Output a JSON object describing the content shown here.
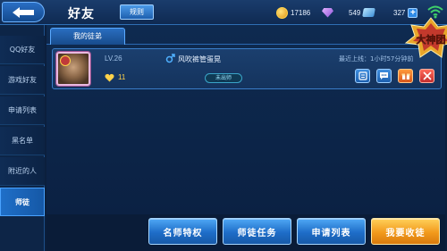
{
  "header": {
    "title": "好友",
    "rules_label": "规则",
    "coins": "17186",
    "gems": "549",
    "tickets": "327",
    "plus_label": "+"
  },
  "sidebar": {
    "items": [
      {
        "label": "QQ好友"
      },
      {
        "label": "游戏好友"
      },
      {
        "label": "申请列表"
      },
      {
        "label": "黑名单"
      },
      {
        "label": "附近的人"
      },
      {
        "label": "师徒"
      }
    ],
    "active_index": 5
  },
  "tabs": {
    "active_label": "我的徒弟"
  },
  "disciple": {
    "level": "LV.26",
    "name": "风吹裤管蛋晃",
    "last_online": "最近上线：1小时57分钟前",
    "intimacy": "11",
    "status": "未出师"
  },
  "event": {
    "logo_text": "大神团"
  },
  "bottom": {
    "btn1": "名师特权",
    "btn2": "师徒任务",
    "btn3": "申请列表",
    "btn4": "我要收徒"
  },
  "colors": {
    "accent_blue": "#1e6dc8",
    "accent_orange": "#f29a1c",
    "background": "#0b1f3d"
  }
}
